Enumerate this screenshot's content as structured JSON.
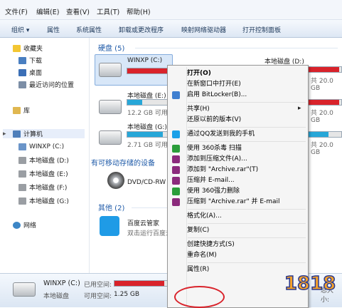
{
  "menubar": [
    "文件(F)",
    "编辑(E)",
    "查看(V)",
    "工具(T)",
    "帮助(H)"
  ],
  "toolbar": [
    "组织 ▾",
    "属性",
    "系统属性",
    "卸载或更改程序",
    "映射网络驱动器",
    "打开控制面板"
  ],
  "nav": {
    "favorites": "收藏夹",
    "downloads": "下载",
    "desktop": "桌面",
    "recent": "最近访问的位置",
    "libraries": "库",
    "computer": "计算机",
    "drives": [
      "WINXP (C:)",
      "本地磁盘 (D:)",
      "本地磁盘 (E:)",
      "本地磁盘 (F:)",
      "本地磁盘 (G:)"
    ],
    "network": "网络"
  },
  "content": {
    "hdd_header": "硬盘 (5)",
    "drives": [
      {
        "name": "WINXP (C:)",
        "free": "",
        "used_fraction": 0.97,
        "color": "#d9232b"
      },
      {
        "name": "本地磁盘 (E:)",
        "free": "12.2 GB 可用，共 20.0 GB",
        "used_fraction": 0.37,
        "color": "#27a7d8"
      },
      {
        "name": "本地磁盘 (G:)",
        "free": "2.71 GB 可用，共 20.0 GB",
        "used_fraction": 0.87,
        "color": "#27a7d8"
      },
      {
        "name": "本地磁盘 (D:)",
        "free": "1.2 共 20.0 GB",
        "used_fraction": 0.94,
        "color": "#d9232b"
      },
      {
        "name": "",
        "free": "共 20.0 GB",
        "used_fraction": 0.94,
        "color": "#d9232b"
      },
      {
        "name": "",
        "free": "共 20.0 GB",
        "used_fraction": 0.6,
        "color": "#27a7d8"
      }
    ],
    "removable_header": "有可移动存储的设备",
    "dvd": "DVD/CD-RW",
    "other_header": "其他 (2)",
    "baidu_name": "百度云管家",
    "baidu_desc": "双击运行百度云"
  },
  "context_menu": [
    {
      "label": "打开(O)",
      "bold": true
    },
    {
      "label": "在新窗口中打开(E)"
    },
    {
      "label": "启用 BitLocker(B)...",
      "icon": "shield-icon"
    },
    {
      "sep": true
    },
    {
      "label": "共享(H)",
      "submenu": true
    },
    {
      "label": "还原以前的版本(V)"
    },
    {
      "sep": true
    },
    {
      "label": "通过QQ发送到我的手机",
      "icon": "qq-icon"
    },
    {
      "sep": true
    },
    {
      "label": "使用 360杀毒 扫描",
      "icon": "360-icon"
    },
    {
      "label": "添加到压缩文件(A)...",
      "icon": "winrar-icon"
    },
    {
      "label": "添加到 \"Archive.rar\"(T)",
      "icon": "winrar-icon"
    },
    {
      "label": "压缩并 E-mail...",
      "icon": "winrar-icon"
    },
    {
      "label": "使用 360强力删除",
      "icon": "360-icon"
    },
    {
      "label": "压缩到 \"Archive.rar\" 并 E-mail",
      "icon": "winrar-icon"
    },
    {
      "sep": true
    },
    {
      "label": "格式化(A)..."
    },
    {
      "sep": true
    },
    {
      "label": "复制(C)"
    },
    {
      "sep": true
    },
    {
      "label": "创建快捷方式(S)"
    },
    {
      "label": "重命名(M)"
    },
    {
      "sep": true
    },
    {
      "label": "属性(R)"
    }
  ],
  "status": {
    "name": "WINXP (C:)",
    "used_label": "已用空间:",
    "type": "本地磁盘",
    "free_label": "可用空间:",
    "free_value": "1.25 GB",
    "used_fraction": 0.94,
    "total_label": "总大小:"
  },
  "watermark": "1818"
}
